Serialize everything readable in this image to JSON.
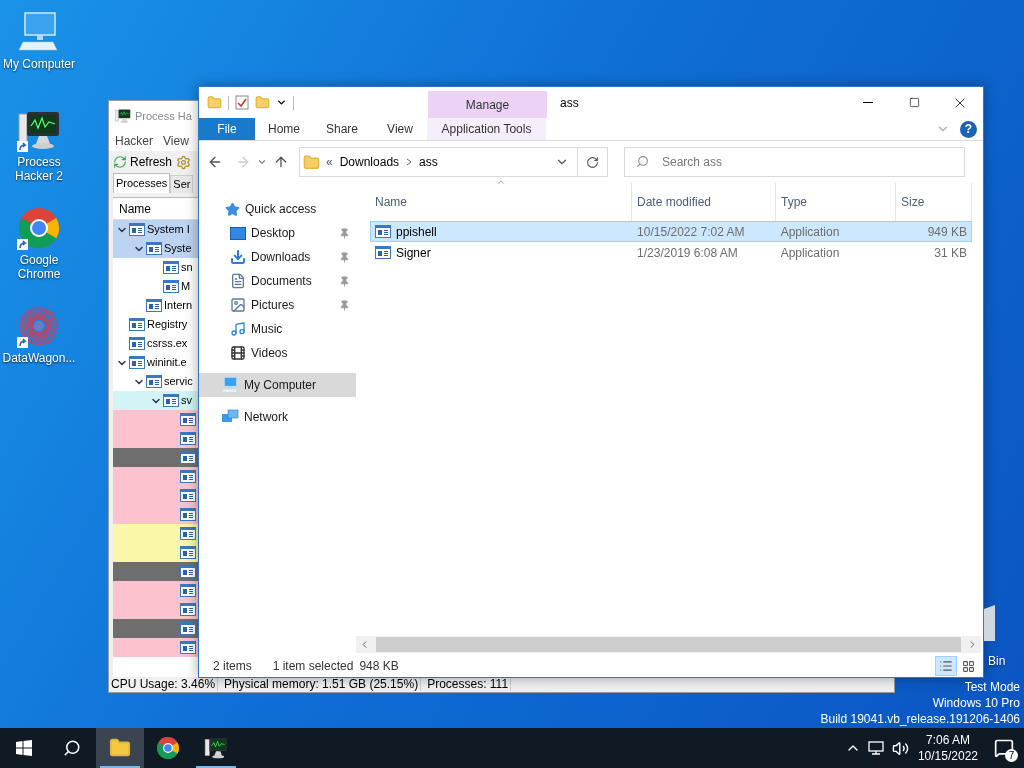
{
  "desktop_icons": [
    {
      "label": "My Computer",
      "kind": "computer",
      "shortcut": false
    },
    {
      "label": "Process Hacker 2",
      "kind": "monitor",
      "shortcut": true
    },
    {
      "label": "Google Chrome",
      "kind": "chrome",
      "shortcut": true
    },
    {
      "label": "DataWagon...",
      "kind": "star",
      "shortcut": true
    }
  ],
  "process_hacker": {
    "title": "Process Ha",
    "menu": [
      "Hacker",
      "View"
    ],
    "refresh": "Refresh",
    "tabs": [
      {
        "label": "Processes",
        "selected": true
      },
      {
        "label": "Ser",
        "selected": false
      }
    ],
    "column": "Name",
    "tree": [
      {
        "name": "System I",
        "selected": true,
        "expanded": true,
        "children": [
          {
            "name": "Syste",
            "selected": true,
            "expanded": true,
            "children": [
              {
                "name": "sn",
                "selected": false
              },
              {
                "name": "M",
                "selected": false
              }
            ]
          },
          {
            "name": "Intern",
            "selected": false
          }
        ]
      },
      {
        "name": "Registry",
        "selected": false
      },
      {
        "name": "csrss.ex",
        "selected": false
      },
      {
        "name": "wininit.e",
        "selected": false,
        "expanded": true,
        "children": [
          {
            "name": "servic",
            "selected": false,
            "expanded": true,
            "children": [
              {
                "name": "sv",
                "selected": false,
                "color": "#d2f4f7",
                "expanded": true,
                "children": [
                  {
                    "selected": false,
                    "color": "#fcc3cf"
                  },
                  {
                    "selected": false,
                    "color": "#fcc3cf"
                  },
                  {
                    "selected": false,
                    "color": "#6e6e6e"
                  },
                  {
                    "selected": false,
                    "color": "#fcc3cf"
                  },
                  {
                    "selected": false,
                    "color": "#fcc3cf"
                  },
                  {
                    "selected": false,
                    "color": "#fcc3cf"
                  },
                  {
                    "selected": false,
                    "color": "#fbf7a8"
                  },
                  {
                    "selected": false,
                    "color": "#fbf7a8"
                  },
                  {
                    "selected": false,
                    "color": "#6e6e6e"
                  },
                  {
                    "selected": false,
                    "color": "#fcc3cf"
                  },
                  {
                    "selected": false,
                    "color": "#fcc3cf"
                  },
                  {
                    "selected": false,
                    "color": "#6e6e6e"
                  },
                  {
                    "selected": false,
                    "color": "#fcc3cf"
                  }
                ]
              }
            ]
          }
        ]
      }
    ],
    "status": [
      "CPU Usage: 3.46%",
      "Physical memory: 1.51 GB (25.15%)",
      "Processes: 111"
    ]
  },
  "explorer": {
    "title": "ass",
    "context_tab": "Manage",
    "ribbon_tabs": [
      {
        "label": "File",
        "kind": "file",
        "selected": false
      },
      {
        "label": "Home",
        "kind": "tab",
        "selected": false
      },
      {
        "label": "Share",
        "kind": "tab",
        "selected": false
      },
      {
        "label": "View",
        "kind": "tab",
        "selected": false
      },
      {
        "label": "Application Tools",
        "kind": "context",
        "selected": false
      }
    ],
    "help": "?",
    "forward_disabled": true,
    "address": {
      "prefix": "«",
      "path": [
        "Downloads",
        "ass"
      ]
    },
    "search": {
      "placeholder": "Search ass"
    },
    "nav": [
      {
        "label": "Quick access",
        "kind": "star",
        "selected": false,
        "children": [
          {
            "label": "Desktop",
            "kind": "desktop",
            "pinned": true,
            "selected": false
          },
          {
            "label": "Downloads",
            "kind": "download",
            "pinned": true,
            "selected": false
          },
          {
            "label": "Documents",
            "kind": "document",
            "pinned": true,
            "selected": false
          },
          {
            "label": "Pictures",
            "kind": "pictures",
            "pinned": true,
            "selected": false
          },
          {
            "label": "Music",
            "kind": "music",
            "pinned": false,
            "selected": false
          },
          {
            "label": "Videos",
            "kind": "videos",
            "pinned": false,
            "selected": false
          }
        ]
      },
      {
        "label": "My Computer",
        "kind": "computer",
        "selected": true
      },
      {
        "label": "Network",
        "kind": "network",
        "selected": false
      }
    ],
    "columns": [
      "Name",
      "Date modified",
      "Type",
      "Size"
    ],
    "files": [
      {
        "name": "ppishell",
        "date": "10/15/2022 7:02 AM",
        "type": "Application",
        "size": "949 KB",
        "selected": true
      },
      {
        "name": "Signer",
        "date": "1/23/2019 6:08 AM",
        "type": "Application",
        "size": "31 KB",
        "selected": false
      }
    ],
    "status": {
      "count": "2 items",
      "selection": "1 item selected",
      "size": "948 KB"
    },
    "views": [
      {
        "kind": "details",
        "selected": true
      },
      {
        "kind": "large",
        "selected": false
      }
    ]
  },
  "recycle_bin": {
    "label": "Bin"
  },
  "desktop_notice": [
    "Test Mode",
    "Windows 10 Pro",
    "Build 19041.vb_release.191206-1406"
  ],
  "taskbar": {
    "apps": [
      {
        "kind": "explorer",
        "active": true,
        "running": true
      },
      {
        "kind": "chrome",
        "active": false,
        "running": false
      },
      {
        "kind": "monitor",
        "active": false,
        "running": true
      }
    ],
    "time": "7:06 AM",
    "date": "10/15/2022",
    "notifications": "7"
  }
}
